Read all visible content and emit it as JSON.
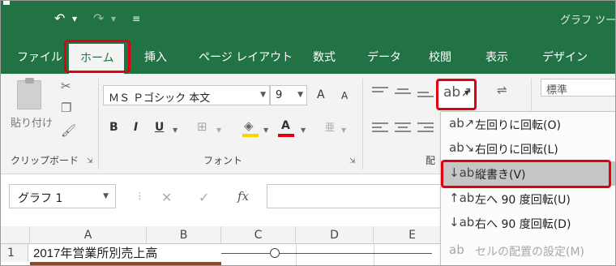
{
  "title_bar": {
    "title": "グラフ ツール"
  },
  "tabs": [
    {
      "label": "ファイル"
    },
    {
      "label": "ホーム"
    },
    {
      "label": "挿入"
    },
    {
      "label": "ページ レイアウト"
    },
    {
      "label": "数式"
    },
    {
      "label": "データ"
    },
    {
      "label": "校閲"
    },
    {
      "label": "表示"
    },
    {
      "label": "デザイン"
    }
  ],
  "clipboard": {
    "paste_label": "貼り付け",
    "group_label": "クリップボード"
  },
  "font": {
    "name": "ＭＳ Ｐゴシック 本文",
    "size": "9",
    "bold": "B",
    "italic": "I",
    "underline": "U",
    "grow": "A",
    "shrink": "A",
    "group_label": "フォント"
  },
  "alignment": {
    "group_label": "配"
  },
  "number": {
    "style": "標準"
  },
  "name_box": {
    "value": "グラフ 1"
  },
  "formula_bar": {
    "fx": "fx"
  },
  "columns": [
    "A",
    "B",
    "C",
    "D",
    "E"
  ],
  "rows": [
    {
      "num": "1",
      "a": "2017年営業所別売上高"
    }
  ],
  "orientation_menu": {
    "items": [
      {
        "label": "左回りに回転(O)",
        "icon": "rotate-ccw-text-icon",
        "glyph": "ab↗"
      },
      {
        "label": "右回りに回転(L)",
        "icon": "rotate-cw-text-icon",
        "glyph": "ab↘"
      },
      {
        "label": "縦書き(V)",
        "icon": "vertical-text-icon",
        "glyph": "↓ab"
      },
      {
        "label": "左へ 90 度回転(U)",
        "icon": "rotate-up-icon",
        "glyph": "↑ab"
      },
      {
        "label": "右へ 90 度回転(D)",
        "icon": "rotate-down-icon",
        "glyph": "↓ab"
      },
      {
        "label": "セルの配置の設定(M)",
        "icon": "format-alignment-icon",
        "glyph": "ab"
      }
    ]
  },
  "colors": {
    "excel_green": "#217346",
    "highlight_red": "#e00012"
  }
}
